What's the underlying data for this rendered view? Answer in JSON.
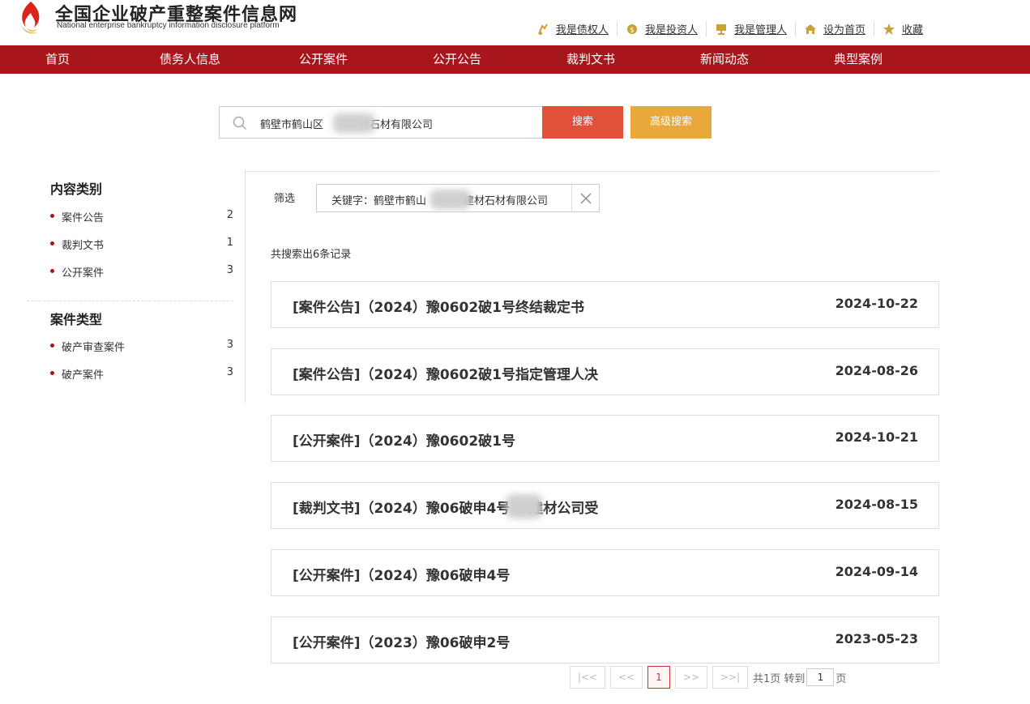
{
  "site": {
    "title": "全国企业破产重整案件信息网",
    "subtitle": "National enterprise bankruptcy  information disclosure platform"
  },
  "toplinks": [
    {
      "label": "我是债权人",
      "icon": "creditor-icon"
    },
    {
      "label": "我是投资人",
      "icon": "investor-icon"
    },
    {
      "label": "我是管理人",
      "icon": "manager-icon"
    },
    {
      "label": "设为首页",
      "icon": "home-icon"
    },
    {
      "label": "收藏",
      "icon": "star-icon"
    }
  ],
  "nav": [
    "首页",
    "债务人信息",
    "公开案件",
    "公开公告",
    "裁判文书",
    "新闻动态",
    "典型案例"
  ],
  "search": {
    "value": "鹤壁市鹤山区",
    "value_tail": "材石材有限公司",
    "search_label": "搜索",
    "advanced_label": "高级搜索"
  },
  "sidebar": {
    "content_title": "内容类别",
    "content_items": [
      {
        "label": "案件公告",
        "count": "2"
      },
      {
        "label": "裁判文书",
        "count": "1"
      },
      {
        "label": "公开案件",
        "count": "3"
      }
    ],
    "type_title": "案件类型",
    "type_items": [
      {
        "label": "破产审查案件",
        "count": "3"
      },
      {
        "label": "破产案件",
        "count": "3"
      }
    ]
  },
  "filter": {
    "label": "筛选",
    "tag_prefix": "关键字：鹤壁市鹤山",
    "tag_suffix": "建材石材有限公司"
  },
  "result_count": "共搜索出6条记录",
  "results": [
    {
      "title": "[案件公告]（2024）豫0602破1号终结裁定书",
      "date": "2024-10-22"
    },
    {
      "title": "[案件公告]（2024）豫0602破1号指定管理人决",
      "date": "2024-08-26"
    },
    {
      "title": "[公开案件]（2024）豫0602破1号",
      "date": "2024-10-21"
    },
    {
      "title": "[裁判文书]（2024）豫06破申4号",
      "title_tail": "建材公司受",
      "date": "2024-08-15"
    },
    {
      "title": "[公开案件]（2024）豫06破申4号",
      "date": "2024-09-14"
    },
    {
      "title": "[公开案件]（2023）豫06破申2号",
      "date": "2023-05-23"
    }
  ],
  "pager": {
    "first": "|<<",
    "prev": "<<",
    "current": "1",
    "next": ">>",
    "last": ">>|",
    "total": "共1页 转到",
    "goto": "1",
    "suffix": "页"
  },
  "colors": {
    "brand": "#a8161b",
    "search": "#e3503a",
    "advanced": "#e8a93a"
  }
}
